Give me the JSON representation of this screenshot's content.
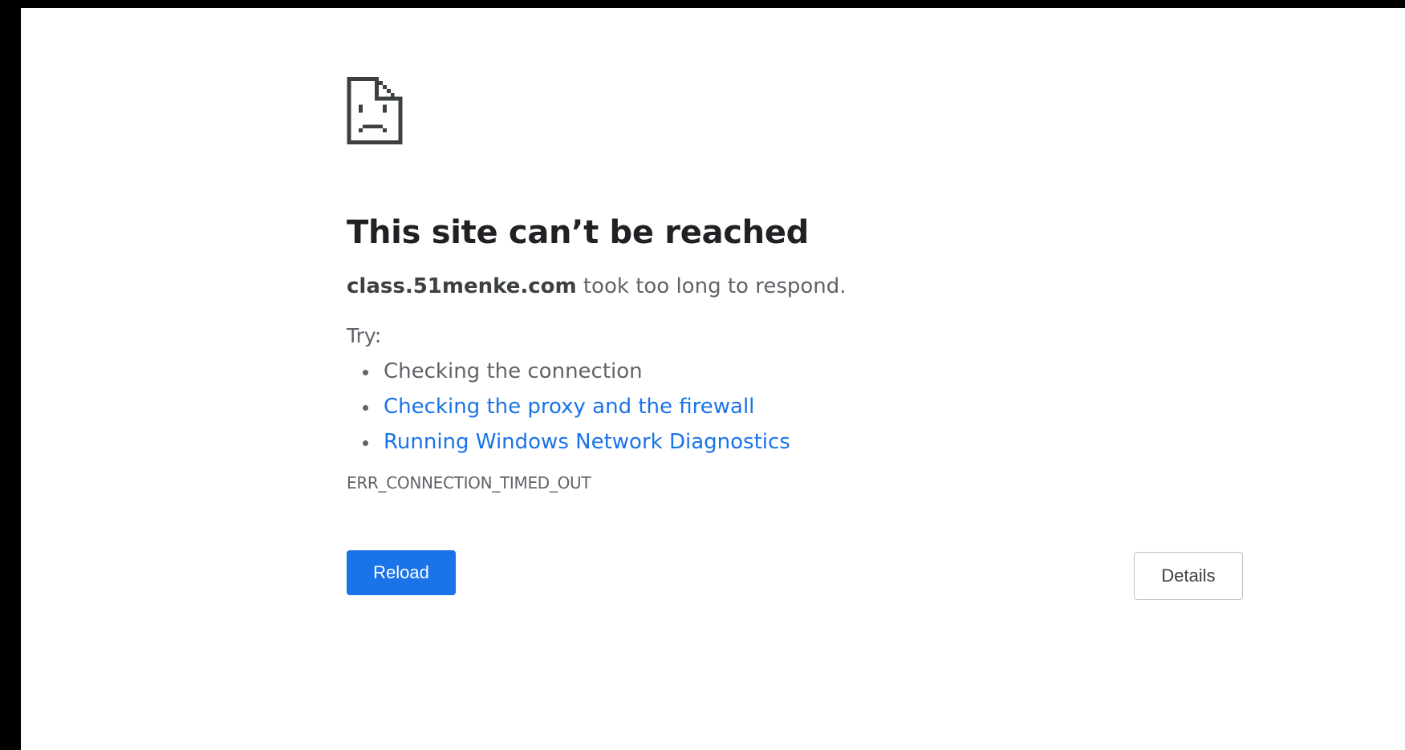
{
  "error_page": {
    "icon": "sad-page-icon",
    "title": "This site can’t be reached",
    "host": "class.51menke.com",
    "message": " took too long to respond.",
    "try_label": "Try:",
    "suggestions": [
      {
        "label": "Checking the connection",
        "link": false
      },
      {
        "label": "Checking the proxy and the firewall",
        "link": true
      },
      {
        "label": "Running Windows Network Diagnostics",
        "link": true
      }
    ],
    "error_code": "ERR_CONNECTION_TIMED_OUT"
  },
  "buttons": {
    "reload_label": "Reload",
    "details_label": "Details"
  },
  "colors": {
    "accent": "#1a73e8",
    "title_text": "#202124",
    "body_text": "#5f6368",
    "icon": "#3c4043"
  }
}
